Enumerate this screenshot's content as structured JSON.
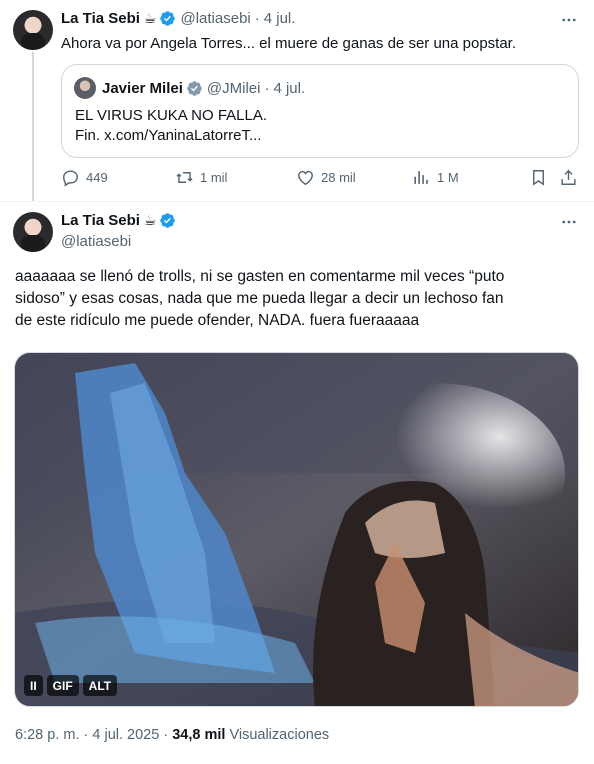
{
  "first_tweet": {
    "display_name": "La Tia Sebi",
    "emoji": "☕",
    "handle": "@latiasebi",
    "separator": "·",
    "date": "4 jul.",
    "text": "Ahora va por Angela Torres... el muere de ganas de ser una popstar.",
    "quote": {
      "display_name": "Javier Milei",
      "handle": "@JMilei",
      "separator": "·",
      "date": "4 jul.",
      "line1": "EL VIRUS KUKA NO FALLA.",
      "line2": "Fin. x.com/YaninaLatorreT..."
    },
    "actions": {
      "replies": "449",
      "reposts": "1 mil",
      "likes": "28 mil",
      "views": "1 M"
    }
  },
  "main_tweet": {
    "display_name": "La Tia Sebi",
    "emoji": "☕",
    "handle": "@latiasebi",
    "text_lines": [
      "aaaaaaa se llenó de trolls, ni se gasten en comentarme mil veces  “puto",
      "sidoso” y esas cosas, nada que me pueda llegar a decir un lechoso fan",
      "de este ridículo me puede ofender, NADA.   fuera fueraaaaa"
    ],
    "media": {
      "pause_label": "II",
      "gif_label": "GIF",
      "alt_label": "ALT"
    },
    "timestamp": "6:28 p. m.",
    "separator": "·",
    "date": "4 jul. 2025",
    "separator2": "·",
    "views_count": "34,8 mil",
    "views_label": "Visualizaciones"
  },
  "colors": {
    "verified": "#1d9bf0",
    "text": "#0f1419",
    "muted": "#536471",
    "border": "#cfd9de"
  },
  "icons": [
    "verified-badge-icon",
    "more-options-icon",
    "reply-icon",
    "repost-icon",
    "like-icon",
    "views-icon",
    "bookmark-icon",
    "share-icon"
  ]
}
